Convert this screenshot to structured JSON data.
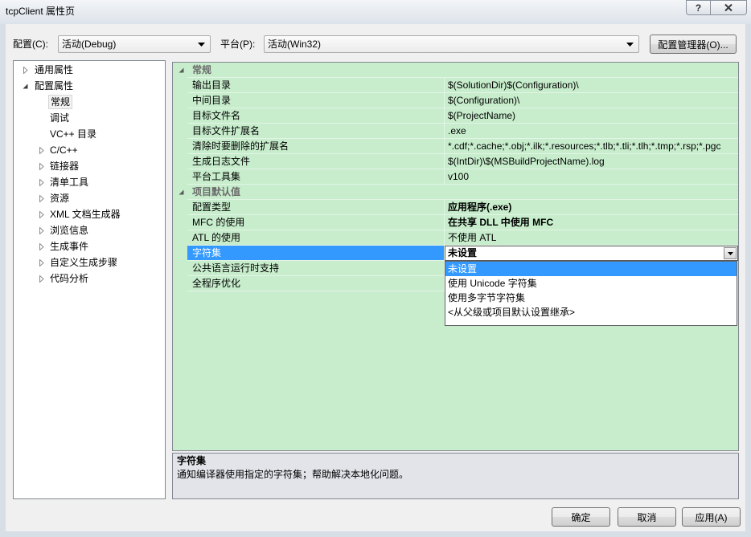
{
  "window": {
    "title": "tcpClient 属性页",
    "help_label": "?",
    "close_icon": "close-icon"
  },
  "toolbar": {
    "config_label": "配置(C):",
    "config_value": "活动(Debug)",
    "platform_label": "平台(P):",
    "platform_value": "活动(Win32)",
    "config_manager_label": "配置管理器(O)..."
  },
  "tree": {
    "items": [
      {
        "label": "通用属性",
        "icon": "collapsed-arrow-icon"
      },
      {
        "label": "配置属性",
        "icon": "expanded-arrow-icon"
      },
      {
        "label": "常规",
        "selected": true
      },
      {
        "label": "调试"
      },
      {
        "label": "VC++ 目录"
      },
      {
        "label": "C/C++",
        "icon": "collapsed-arrow-icon"
      },
      {
        "label": "链接器",
        "icon": "collapsed-arrow-icon"
      },
      {
        "label": "清单工具",
        "icon": "collapsed-arrow-icon"
      },
      {
        "label": "资源",
        "icon": "collapsed-arrow-icon"
      },
      {
        "label": "XML 文档生成器",
        "icon": "collapsed-arrow-icon"
      },
      {
        "label": "浏览信息",
        "icon": "collapsed-arrow-icon"
      },
      {
        "label": "生成事件",
        "icon": "collapsed-arrow-icon"
      },
      {
        "label": "自定义生成步骤",
        "icon": "collapsed-arrow-icon"
      },
      {
        "label": "代码分析",
        "icon": "collapsed-arrow-icon"
      }
    ]
  },
  "grid": {
    "categories": [
      {
        "label": "常规",
        "rows": [
          {
            "name": "输出目录",
            "value": "$(SolutionDir)$(Configuration)\\"
          },
          {
            "name": "中间目录",
            "value": "$(Configuration)\\"
          },
          {
            "name": "目标文件名",
            "value": "$(ProjectName)"
          },
          {
            "name": "目标文件扩展名",
            "value": ".exe"
          },
          {
            "name": "清除时要删除的扩展名",
            "value": "*.cdf;*.cache;*.obj;*.ilk;*.resources;*.tlb;*.tli;*.tlh;*.tmp;*.rsp;*.pgc"
          },
          {
            "name": "生成日志文件",
            "value": "$(IntDir)\\$(MSBuildProjectName).log"
          },
          {
            "name": "平台工具集",
            "value": "v100"
          }
        ]
      },
      {
        "label": "项目默认值",
        "rows": [
          {
            "name": "配置类型",
            "value": "应用程序(.exe)"
          },
          {
            "name": "MFC 的使用",
            "value": "在共享 DLL 中使用 MFC"
          },
          {
            "name": "ATL 的使用",
            "value": "不使用 ATL"
          },
          {
            "name": "字符集",
            "value": "未设置",
            "selected": true
          },
          {
            "name": "公共语言运行时支持"
          },
          {
            "name": "全程序优化"
          }
        ]
      }
    ]
  },
  "dropdown": {
    "options": [
      "未设置",
      "使用 Unicode 字符集",
      "使用多字节字符集",
      "<从父级或项目默认设置继承>"
    ],
    "highlighted_index": 0
  },
  "description": {
    "title": "字符集",
    "text": "通知编译器使用指定的字符集；帮助解决本地化问题。"
  },
  "buttons": {
    "ok": "确定",
    "cancel": "取消",
    "apply": "应用(A)"
  },
  "colors": {
    "grid_background": "#C7EDCC",
    "selection": "#3399FF",
    "description_background": "#E3E4EA"
  }
}
